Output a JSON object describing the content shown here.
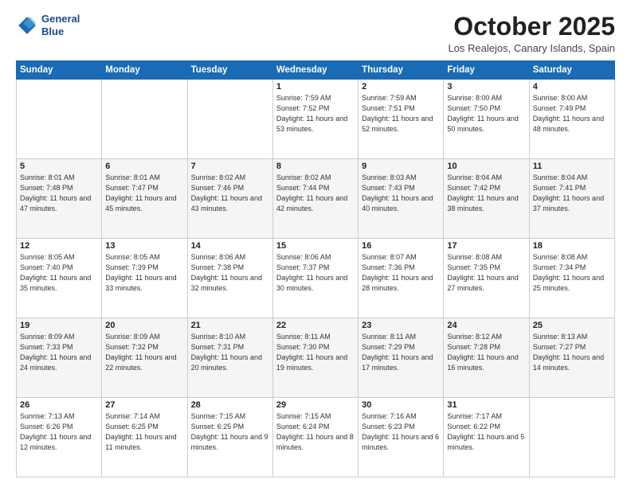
{
  "header": {
    "logo_line1": "General",
    "logo_line2": "Blue",
    "month_title": "October 2025",
    "location": "Los Realejos, Canary Islands, Spain"
  },
  "days_of_week": [
    "Sunday",
    "Monday",
    "Tuesday",
    "Wednesday",
    "Thursday",
    "Friday",
    "Saturday"
  ],
  "weeks": [
    [
      {
        "day": "",
        "info": ""
      },
      {
        "day": "",
        "info": ""
      },
      {
        "day": "",
        "info": ""
      },
      {
        "day": "1",
        "info": "Sunrise: 7:59 AM\nSunset: 7:52 PM\nDaylight: 11 hours\nand 53 minutes."
      },
      {
        "day": "2",
        "info": "Sunrise: 7:59 AM\nSunset: 7:51 PM\nDaylight: 11 hours\nand 52 minutes."
      },
      {
        "day": "3",
        "info": "Sunrise: 8:00 AM\nSunset: 7:50 PM\nDaylight: 11 hours\nand 50 minutes."
      },
      {
        "day": "4",
        "info": "Sunrise: 8:00 AM\nSunset: 7:49 PM\nDaylight: 11 hours\nand 48 minutes."
      }
    ],
    [
      {
        "day": "5",
        "info": "Sunrise: 8:01 AM\nSunset: 7:48 PM\nDaylight: 11 hours\nand 47 minutes."
      },
      {
        "day": "6",
        "info": "Sunrise: 8:01 AM\nSunset: 7:47 PM\nDaylight: 11 hours\nand 45 minutes."
      },
      {
        "day": "7",
        "info": "Sunrise: 8:02 AM\nSunset: 7:46 PM\nDaylight: 11 hours\nand 43 minutes."
      },
      {
        "day": "8",
        "info": "Sunrise: 8:02 AM\nSunset: 7:44 PM\nDaylight: 11 hours\nand 42 minutes."
      },
      {
        "day": "9",
        "info": "Sunrise: 8:03 AM\nSunset: 7:43 PM\nDaylight: 11 hours\nand 40 minutes."
      },
      {
        "day": "10",
        "info": "Sunrise: 8:04 AM\nSunset: 7:42 PM\nDaylight: 11 hours\nand 38 minutes."
      },
      {
        "day": "11",
        "info": "Sunrise: 8:04 AM\nSunset: 7:41 PM\nDaylight: 11 hours\nand 37 minutes."
      }
    ],
    [
      {
        "day": "12",
        "info": "Sunrise: 8:05 AM\nSunset: 7:40 PM\nDaylight: 11 hours\nand 35 minutes."
      },
      {
        "day": "13",
        "info": "Sunrise: 8:05 AM\nSunset: 7:39 PM\nDaylight: 11 hours\nand 33 minutes."
      },
      {
        "day": "14",
        "info": "Sunrise: 8:06 AM\nSunset: 7:38 PM\nDaylight: 11 hours\nand 32 minutes."
      },
      {
        "day": "15",
        "info": "Sunrise: 8:06 AM\nSunset: 7:37 PM\nDaylight: 11 hours\nand 30 minutes."
      },
      {
        "day": "16",
        "info": "Sunrise: 8:07 AM\nSunset: 7:36 PM\nDaylight: 11 hours\nand 28 minutes."
      },
      {
        "day": "17",
        "info": "Sunrise: 8:08 AM\nSunset: 7:35 PM\nDaylight: 11 hours\nand 27 minutes."
      },
      {
        "day": "18",
        "info": "Sunrise: 8:08 AM\nSunset: 7:34 PM\nDaylight: 11 hours\nand 25 minutes."
      }
    ],
    [
      {
        "day": "19",
        "info": "Sunrise: 8:09 AM\nSunset: 7:33 PM\nDaylight: 11 hours\nand 24 minutes."
      },
      {
        "day": "20",
        "info": "Sunrise: 8:09 AM\nSunset: 7:32 PM\nDaylight: 11 hours\nand 22 minutes."
      },
      {
        "day": "21",
        "info": "Sunrise: 8:10 AM\nSunset: 7:31 PM\nDaylight: 11 hours\nand 20 minutes."
      },
      {
        "day": "22",
        "info": "Sunrise: 8:11 AM\nSunset: 7:30 PM\nDaylight: 11 hours\nand 19 minutes."
      },
      {
        "day": "23",
        "info": "Sunrise: 8:11 AM\nSunset: 7:29 PM\nDaylight: 11 hours\nand 17 minutes."
      },
      {
        "day": "24",
        "info": "Sunrise: 8:12 AM\nSunset: 7:28 PM\nDaylight: 11 hours\nand 16 minutes."
      },
      {
        "day": "25",
        "info": "Sunrise: 8:13 AM\nSunset: 7:27 PM\nDaylight: 11 hours\nand 14 minutes."
      }
    ],
    [
      {
        "day": "26",
        "info": "Sunrise: 7:13 AM\nSunset: 6:26 PM\nDaylight: 11 hours\nand 12 minutes."
      },
      {
        "day": "27",
        "info": "Sunrise: 7:14 AM\nSunset: 6:25 PM\nDaylight: 11 hours\nand 11 minutes."
      },
      {
        "day": "28",
        "info": "Sunrise: 7:15 AM\nSunset: 6:25 PM\nDaylight: 11 hours\nand 9 minutes."
      },
      {
        "day": "29",
        "info": "Sunrise: 7:15 AM\nSunset: 6:24 PM\nDaylight: 11 hours\nand 8 minutes."
      },
      {
        "day": "30",
        "info": "Sunrise: 7:16 AM\nSunset: 6:23 PM\nDaylight: 11 hours\nand 6 minutes."
      },
      {
        "day": "31",
        "info": "Sunrise: 7:17 AM\nSunset: 6:22 PM\nDaylight: 11 hours\nand 5 minutes."
      },
      {
        "day": "",
        "info": ""
      }
    ]
  ]
}
